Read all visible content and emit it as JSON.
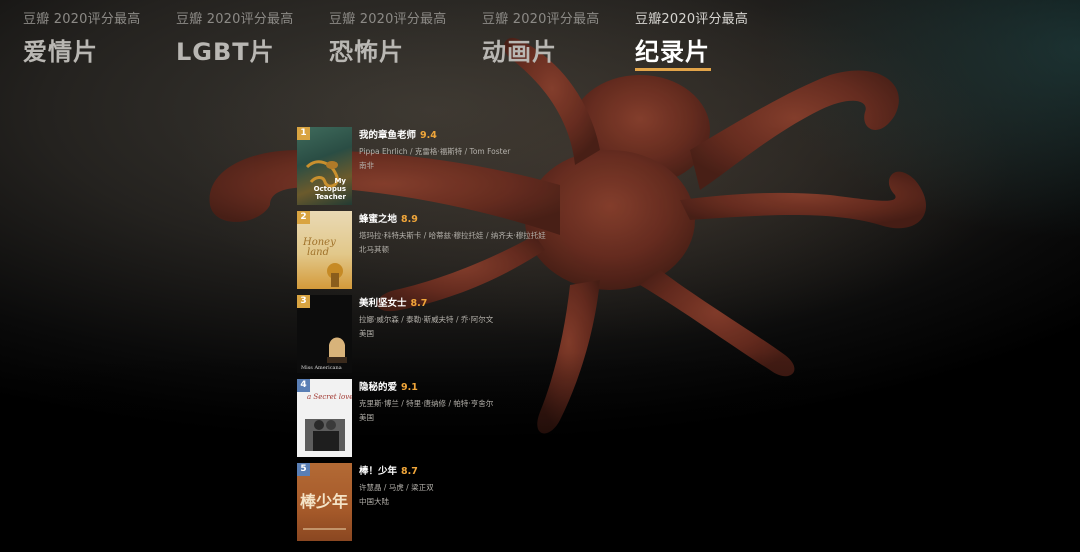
{
  "tabs": [
    {
      "subtitle": "豆瓣 2020评分最高",
      "title": "爱情片",
      "active": false
    },
    {
      "subtitle": "豆瓣 2020评分最高",
      "title": "LGBT片",
      "active": false
    },
    {
      "subtitle": "豆瓣 2020评分最高",
      "title": "恐怖片",
      "active": false
    },
    {
      "subtitle": "豆瓣 2020评分最高",
      "title": "动画片",
      "active": false
    },
    {
      "subtitle": "豆瓣2020评分最高",
      "title": "纪录片",
      "active": true
    }
  ],
  "movies": [
    {
      "rank": "1",
      "title": "我的章鱼老师",
      "score": "9.4",
      "people": "Pippa Ehrlich / 克雷格·福斯特 / Tom Foster",
      "region": "南非",
      "poster_caption": "My Octopus Teacher"
    },
    {
      "rank": "2",
      "title": "蜂蜜之地",
      "score": "8.9",
      "people": "塔玛拉·科特夫斯卡 / 哈蒂兹·穆拉托娃 / 纳齐夫·穆拉托娃",
      "region": "北马其顿",
      "poster_caption": "Honeyland"
    },
    {
      "rank": "3",
      "title": "美利坚女士",
      "score": "8.7",
      "people": "拉娜·威尔森 / 泰勒·斯威夫特 / 乔·阿尔文",
      "region": "美国",
      "poster_caption": "Miss Americana"
    },
    {
      "rank": "4",
      "title": "隐秘的爱",
      "score": "9.1",
      "people": "克里斯·博兰 / 特里·唐纳修 / 帕特·亨舍尔",
      "region": "美国",
      "poster_caption": "A Secret Love"
    },
    {
      "rank": "5",
      "title": "棒！少年",
      "score": "8.7",
      "people": "许慧晶 / 马虎 / 梁正双",
      "region": "中国大陆",
      "poster_caption": "棒少年"
    }
  ],
  "colors": {
    "accent_gold": "#d9a441",
    "score_orange": "#f0a63a",
    "rank_blue": "#5a7fb5"
  }
}
